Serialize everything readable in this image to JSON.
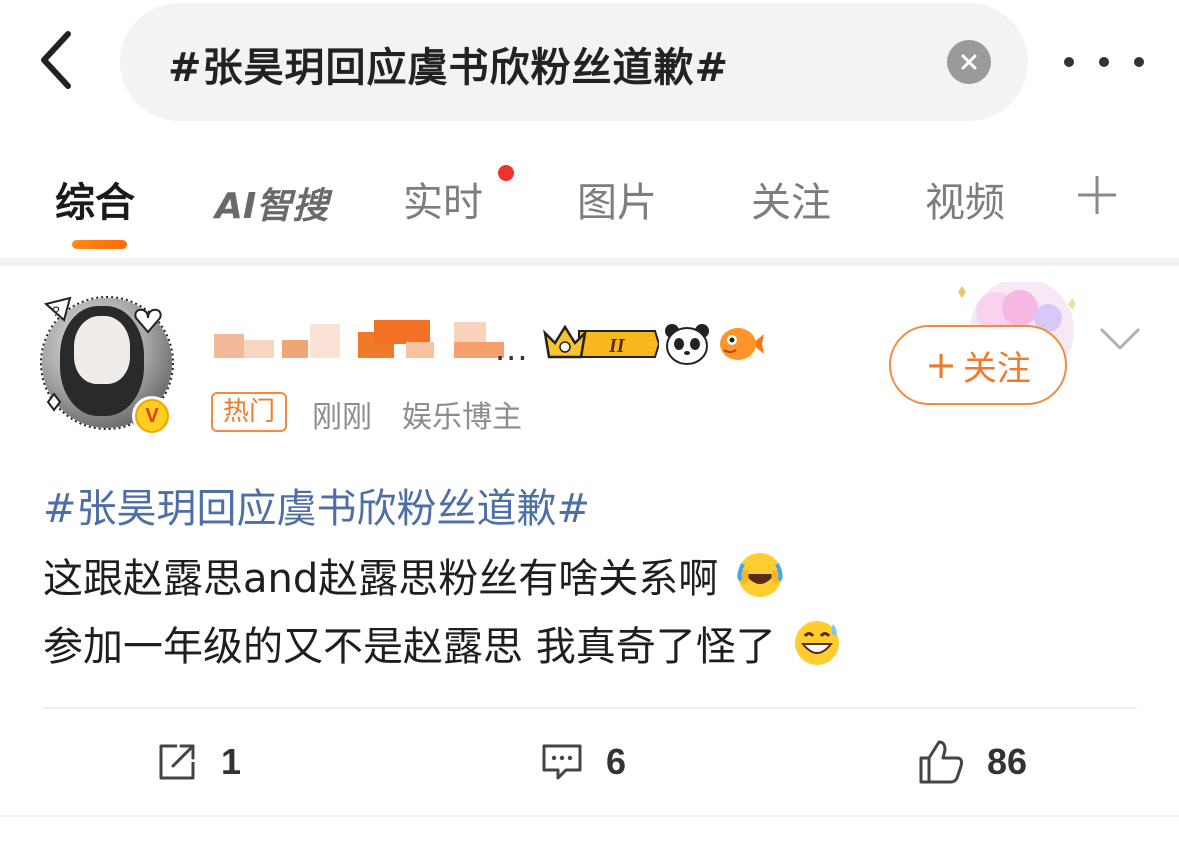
{
  "search": {
    "query": "#张昊玥回应虞书欣粉丝道歉#"
  },
  "tabs": {
    "items": [
      {
        "label": "综合",
        "active": true
      },
      {
        "label": "AI智搜",
        "active": false
      },
      {
        "label": "实时",
        "active": false,
        "has_dot": true
      },
      {
        "label": "图片",
        "active": false
      },
      {
        "label": "关注",
        "active": false
      },
      {
        "label": "视频",
        "active": false
      }
    ],
    "add_icon": "plus-icon"
  },
  "post": {
    "username_suffix": "...",
    "badges": [
      "crown-level-badge",
      "panda-icon",
      "fish-icon"
    ],
    "crown_level": "II",
    "hot_tag": "热门",
    "time": "刚刚",
    "role": "娱乐博主",
    "follow_label": "关注",
    "hashtag": "#张昊玥回应虞书欣粉丝道歉#",
    "line1": "这跟赵露思and赵露思粉丝有啥关系啊",
    "line2": "参加一年级的又不是赵露思 我真奇了怪了",
    "line1_emoji": "laugh-cry-emoji",
    "line2_emoji": "sweat-smile-emoji"
  },
  "actions": {
    "repost_count": "1",
    "comment_count": "6",
    "like_count": "86"
  },
  "colors": {
    "accent": "#f07a2c",
    "hashtag": "#4d6ea7",
    "red_dot": "#f0312c"
  }
}
